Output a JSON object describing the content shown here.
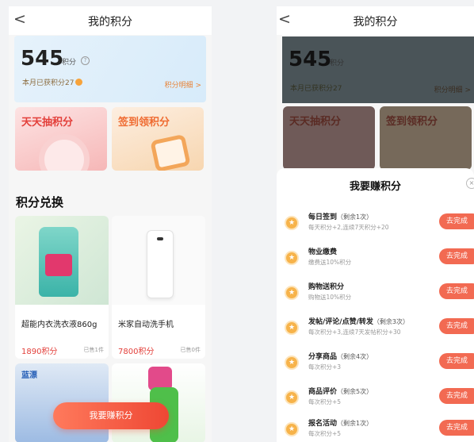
{
  "left": {
    "nav_title": "我的积分",
    "back_glyph": "<",
    "points": {
      "value": "545",
      "unit": "积分",
      "help_glyph": "?",
      "month_text": "本月已获积分27",
      "detail_link": "积分明细 >"
    },
    "promos": {
      "lottery": "天天抽积分",
      "checkin": "签到领积分"
    },
    "section_title": "积分兑换",
    "products": [
      {
        "name": "超能内衣洗衣液860g",
        "price": "1890积分",
        "sold": "已售1件"
      },
      {
        "name": "米家自动洗手机",
        "price": "7800积分",
        "sold": "已售0件"
      }
    ],
    "product3_brand": "蓝漂",
    "cta": "我要赚积分"
  },
  "right": {
    "nav_title": "我的积分",
    "back_glyph": "<",
    "bg": {
      "value": "545",
      "unit": "积分",
      "month_text": "本月已获积分27",
      "detail_link": "积分明细 >",
      "promo1": "天天抽积分",
      "promo2": "签到领积分"
    },
    "sheet_title": "我要赚积分",
    "close_glyph": "×",
    "task_button": "去完成",
    "tasks": [
      {
        "title": "每日签到",
        "remain": "（剩余1次）",
        "desc": "每天积分+2,连续7天积分+20"
      },
      {
        "title": "物业缴费",
        "remain": "",
        "desc": "缴费送10%积分"
      },
      {
        "title": "购物送积分",
        "remain": "",
        "desc": "购物送10%积分"
      },
      {
        "title": "发帖/评论/点赞/转发",
        "remain": "（剩余3次）",
        "desc": "每次积分+3,连续7天发帖积分+30"
      },
      {
        "title": "分享商品",
        "remain": "（剩余4次）",
        "desc": "每次积分+3"
      },
      {
        "title": "商品评价",
        "remain": "（剩余5次）",
        "desc": "每次积分+5"
      },
      {
        "title": "报名活动",
        "remain": "（剩余1次）",
        "desc": "每次积分+5"
      }
    ]
  },
  "colors": {
    "accent": "#ee4734",
    "task_button": "#f26a52",
    "coin": "#f7a33a"
  },
  "icons": [
    "back-arrow-icon",
    "help-circle-icon",
    "coin-icon",
    "close-circle-icon",
    "star-coin-icon"
  ]
}
